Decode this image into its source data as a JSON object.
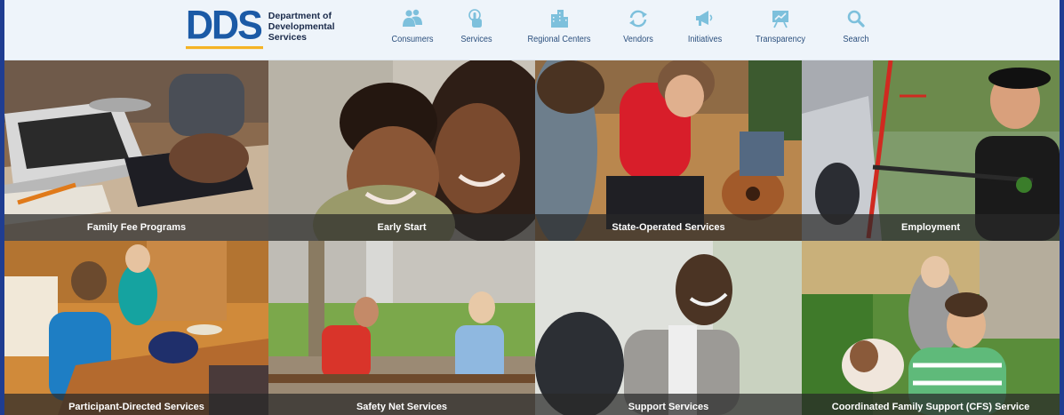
{
  "header": {
    "logo": {
      "mark": "DDS",
      "lines": [
        "Department of",
        "Developmental",
        "Services"
      ]
    },
    "nav": [
      {
        "label": "Consumers",
        "icon": "people-icon"
      },
      {
        "label": "Services",
        "icon": "hand-pointer-icon"
      },
      {
        "label": "Regional Centers",
        "icon": "buildings-icon"
      },
      {
        "label": "Vendors",
        "icon": "refresh-arrows-icon"
      },
      {
        "label": "Initiatives",
        "icon": "megaphone-icon"
      },
      {
        "label": "Transparency",
        "icon": "chart-board-icon"
      },
      {
        "label": "Search",
        "icon": "search-icon"
      }
    ],
    "colors": {
      "icon": "#7dc0dc",
      "label": "#2b4f7d",
      "bar": "#eef4fa"
    }
  },
  "tiles": [
    {
      "label": "Family Fee Programs",
      "photo": "hands-calculator-laptop"
    },
    {
      "label": "Early Start",
      "photo": "mother-and-baby"
    },
    {
      "label": "State-Operated Services",
      "photo": "group-music-session"
    },
    {
      "label": "Employment",
      "photo": "man-pressure-washing-car"
    },
    {
      "label": "Participant-Directed Services",
      "photo": "kitchen-table-activity"
    },
    {
      "label": "Safety Net Services",
      "photo": "couple-on-bench"
    },
    {
      "label": "Support Services",
      "photo": "man-smiling-wheelchair"
    },
    {
      "label": "Coordinated Family Support (CFS) Service",
      "photo": "women-with-dog"
    }
  ]
}
